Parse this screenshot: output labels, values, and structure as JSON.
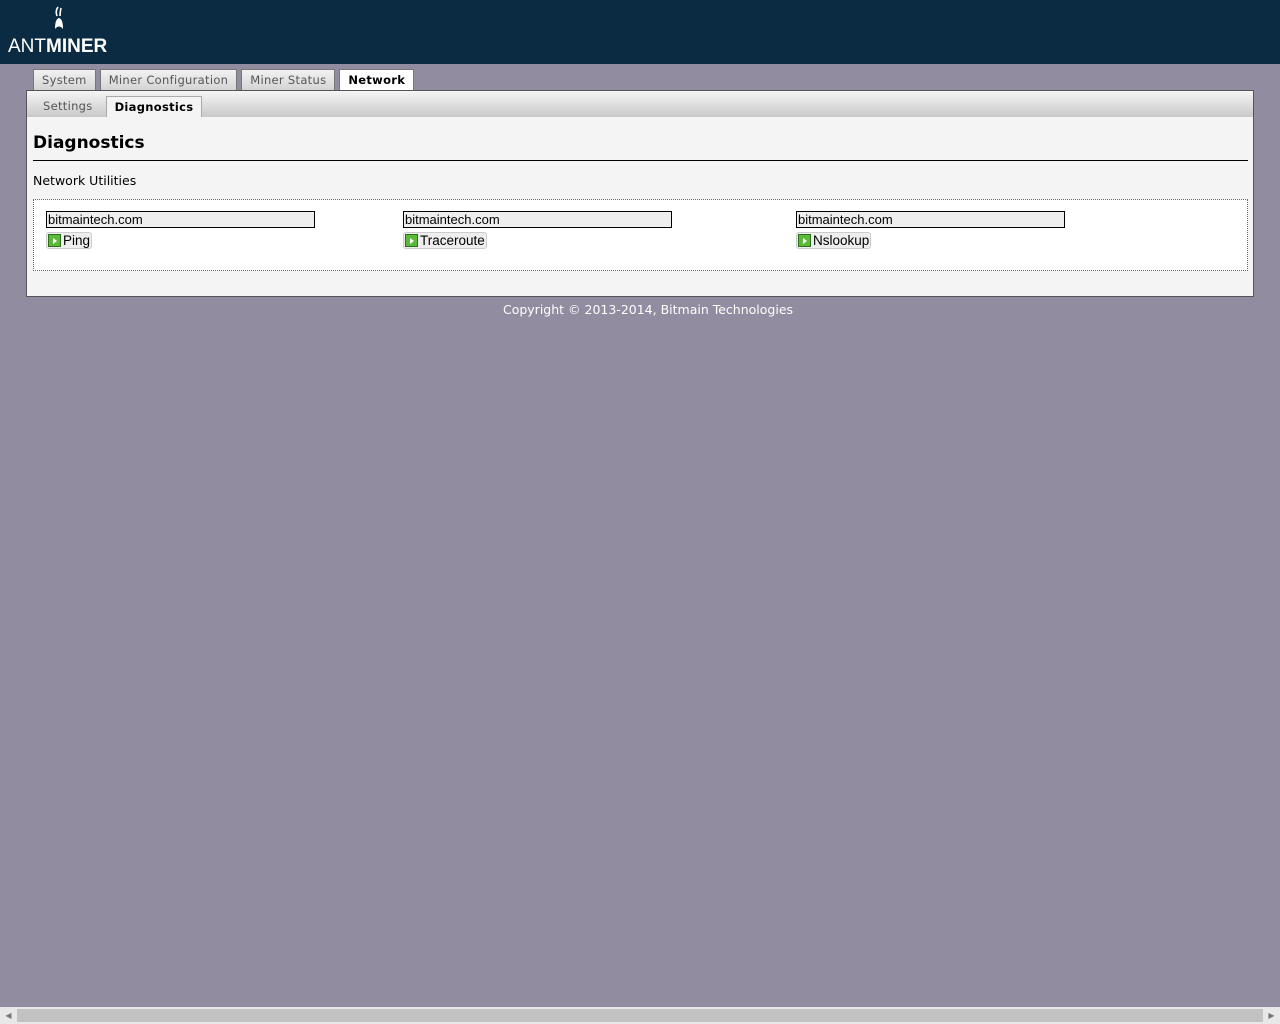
{
  "logo": {
    "text_light": "ANT",
    "text_bold": "MINER"
  },
  "tabs": [
    {
      "label": "System"
    },
    {
      "label": "Miner Configuration"
    },
    {
      "label": "Miner Status"
    },
    {
      "label": "Network"
    }
  ],
  "subtabs": [
    {
      "label": "Settings"
    },
    {
      "label": "Diagnostics"
    }
  ],
  "page_title": "Diagnostics",
  "section_legend": "Network Utilities",
  "tools": [
    {
      "value": "bitmaintech.com",
      "button": "Ping"
    },
    {
      "value": "bitmaintech.com",
      "button": "Traceroute"
    },
    {
      "value": "bitmaintech.com",
      "button": "Nslookup"
    }
  ],
  "footer": "Copyright © 2013-2014, Bitmain Technologies"
}
